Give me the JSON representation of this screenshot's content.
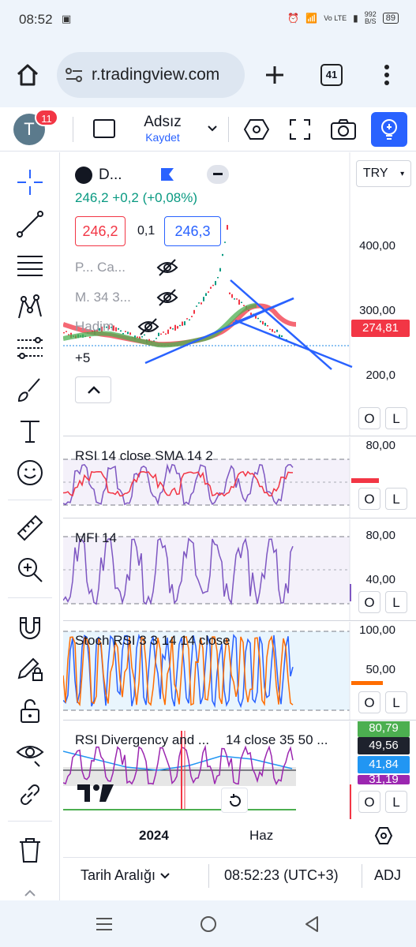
{
  "status_bar": {
    "time": "08:52",
    "net_label": "Vo LTE",
    "speed": "992",
    "speed_unit": "B/S",
    "battery": "89"
  },
  "browser": {
    "url": "r.tradingview.com",
    "tab_count": "41"
  },
  "header": {
    "avatar_letter": "T",
    "notification_count": "11",
    "layout_name": "Adsız",
    "layout_save": "Kaydet"
  },
  "symbol": {
    "name": "D...",
    "currency": "TRY",
    "price": "246,2",
    "change": "+0,2 (+0,08%)",
    "bid": "246,2",
    "spread": "0,1",
    "ask": "246,3",
    "indicator_1": "P... Ca...",
    "indicator_2": "M. 34 3...",
    "indicator_3": "Hadim",
    "more_count": "+5",
    "last_price_tag": "274,81"
  },
  "main_axis": [
    "400,00",
    "300,00",
    "200,0"
  ],
  "panes": {
    "rsi": {
      "title": "RSI 14 close SMA 14 2",
      "axis_top": "80,00"
    },
    "mfi": {
      "title": "MFI 14",
      "axis_top": "80,00",
      "axis_mid": "40,00"
    },
    "stoch": {
      "title": "Stoch RSI 3 3 14 14 close",
      "axis_top": "100,00",
      "axis_mid": "50,00"
    },
    "rsidiv": {
      "title": "RSI Divergency and ...",
      "params": "14 close 35 50 ...",
      "tags": [
        "80,79",
        "49,56",
        "41,84",
        "31,19"
      ]
    }
  },
  "buttons": {
    "o": "O",
    "l": "L"
  },
  "time_axis": [
    "2024",
    "Haz"
  ],
  "bottom_bar": {
    "date_range": "Tarih Aralığı",
    "clock": "08:52:23 (UTC+3)",
    "adj": "ADJ"
  },
  "colors": {
    "up": "#089981",
    "down": "#f23645",
    "blue": "#2962ff",
    "accent_button": "#2962ff"
  }
}
